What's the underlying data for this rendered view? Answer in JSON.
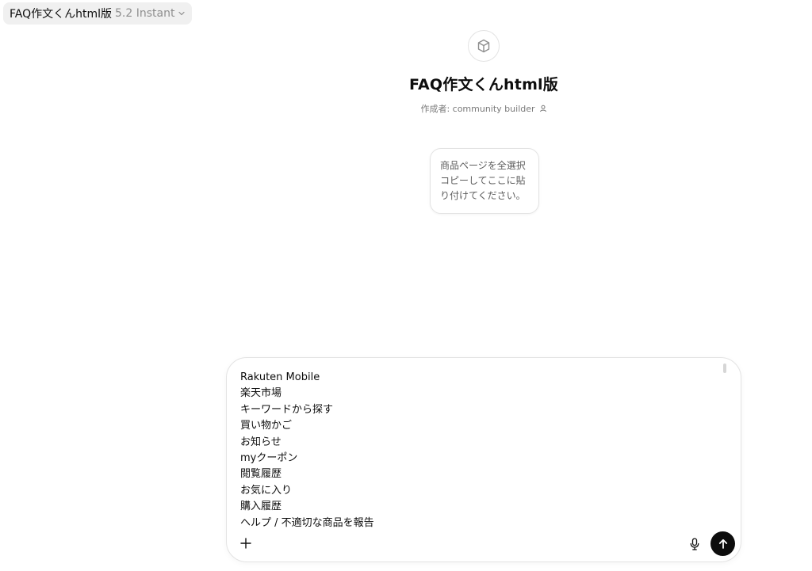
{
  "model_selector": {
    "gpt_name": "FAQ作文くんhtml版",
    "version": "5.2 Instant",
    "icon": "chevron-down-icon"
  },
  "gpt": {
    "avatar_icon": "cube-icon",
    "title": "FAQ作文くんhtml版",
    "author": "作成者: community builder",
    "author_icon": "person-icon"
  },
  "starter": {
    "text": "商品ページを全選択コピーしてここに貼り付けてください。"
  },
  "composer": {
    "lines": [
      "Rakuten Mobile",
      "楽天市場",
      "キーワードから探す",
      "買い物かご",
      "お知らせ",
      "myクーポン",
      "閲覧履歴",
      "お気に入り",
      "購入履歴",
      "ヘルプ / 不適切な商品を報告"
    ],
    "add_icon": "plus-icon",
    "mic_icon": "microphone-icon",
    "send_icon": "arrow-up-icon"
  },
  "colors": {
    "send_button": "#0d0d0d",
    "muted_text": "#7a7a7a",
    "border": "#e3e3e3"
  }
}
